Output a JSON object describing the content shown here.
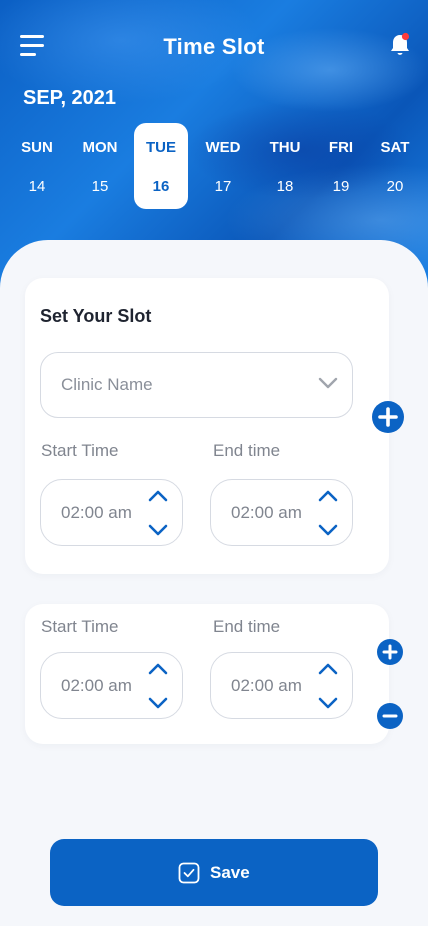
{
  "header": {
    "title": "Time Slot",
    "menu_icon": "hamburger-menu-icon",
    "notification_icon": "bell-icon",
    "notification_dot_color": "#ff3b3b"
  },
  "calendar": {
    "month": "SEP, 2021",
    "selected_index": 2,
    "days": [
      {
        "name": "SUN",
        "num": "14"
      },
      {
        "name": "MON",
        "num": "15"
      },
      {
        "name": "TUE",
        "num": "16"
      },
      {
        "name": "WED",
        "num": "17"
      },
      {
        "name": "THU",
        "num": "18"
      },
      {
        "name": "FRI",
        "num": "19"
      },
      {
        "name": "SAT",
        "num": "20"
      }
    ]
  },
  "slot_card": {
    "title": "Set Your Slot",
    "clinic_placeholder": "Clinic Name",
    "start_label": "Start Time",
    "end_label": "End time",
    "start_value": "02:00 am",
    "end_value": "02:00 am"
  },
  "slot_card_2": {
    "start_label": "Start Time",
    "end_label": "End time",
    "start_value": "02:00 am",
    "end_value": "02:00 am"
  },
  "save_button": {
    "label": "Save"
  },
  "colors": {
    "primary": "#0b63c4",
    "card": "#ffffff",
    "background": "#f5f7fb"
  }
}
